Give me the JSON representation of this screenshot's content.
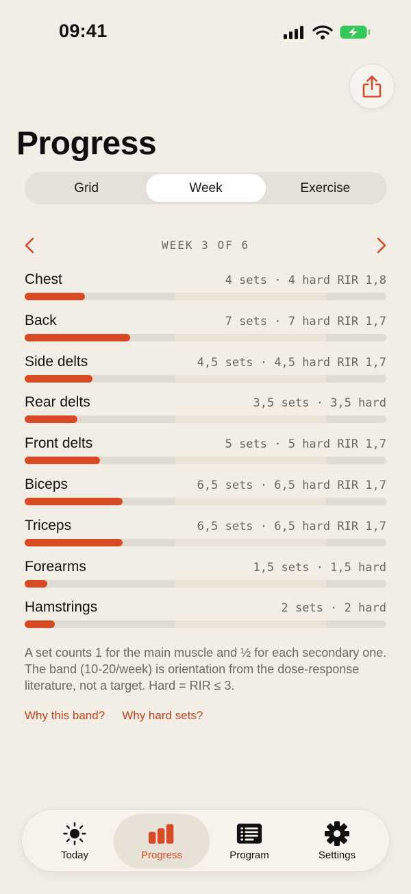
{
  "status_bar": {
    "time": "09:41"
  },
  "header": {
    "title": "Progress"
  },
  "segmented": [
    "Grid",
    "Week",
    "Exercise"
  ],
  "segmented_active": 1,
  "week_nav": {
    "label": "WEEK 3 OF 6"
  },
  "band": {
    "min_sets": 10,
    "max_sets": 20,
    "scale_max": 24
  },
  "muscles": [
    {
      "name": "Chest",
      "stats": "4 sets · 4 hard RIR 1,8",
      "sets": 4
    },
    {
      "name": "Back",
      "stats": "7 sets · 7 hard RIR 1,7",
      "sets": 7
    },
    {
      "name": "Side delts",
      "stats": "4,5 sets · 4,5 hard RIR 1,7",
      "sets": 4.5
    },
    {
      "name": "Rear delts",
      "stats": "3,5 sets · 3,5 hard",
      "sets": 3.5
    },
    {
      "name": "Front delts",
      "stats": "5 sets · 5 hard RIR 1,7",
      "sets": 5
    },
    {
      "name": "Biceps",
      "stats": "6,5 sets · 6,5 hard RIR 1,7",
      "sets": 6.5
    },
    {
      "name": "Triceps",
      "stats": "6,5 sets · 6,5 hard RIR 1,7",
      "sets": 6.5
    },
    {
      "name": "Forearms",
      "stats": "1,5 sets · 1,5 hard",
      "sets": 1.5
    },
    {
      "name": "Hamstrings",
      "stats": "2 sets · 2 hard",
      "sets": 2
    }
  ],
  "footnote": "A set counts 1 for the main muscle and ½ for each secondary one. The band (10-20/week) is orientation from the dose-response literature, not a target. Hard = RIR ≤ 3.",
  "links": {
    "why_band": "Why this band?",
    "why_hard": "Why hard sets?"
  },
  "tabbar": {
    "today": "Today",
    "progress": "Progress",
    "program": "Program",
    "settings": "Settings"
  },
  "colors": {
    "accent": "#d84a23",
    "background": "#f2ede5",
    "track": "#e0dcd4",
    "band": "#ebe4d6",
    "battery": "#34c759"
  },
  "icons": {
    "share": "share-icon",
    "prev": "chevron-left-icon",
    "next": "chevron-right-icon",
    "today": "sun-icon",
    "progress": "bar-chart-icon",
    "program": "list-icon",
    "settings": "gear-icon"
  }
}
